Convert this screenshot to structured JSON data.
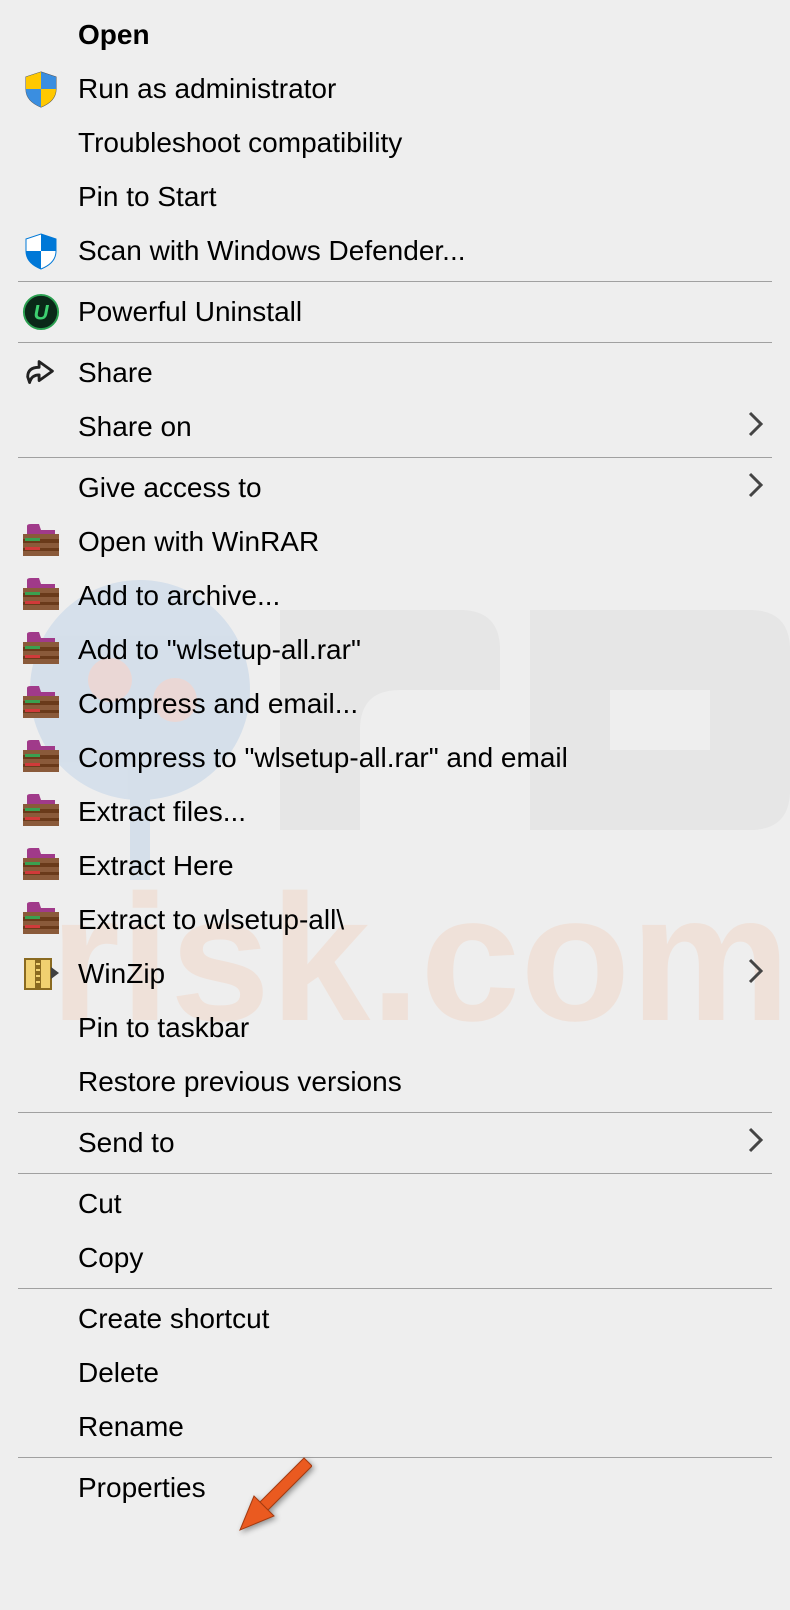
{
  "menu": {
    "open": "Open",
    "run_as_admin": "Run as administrator",
    "troubleshoot": "Troubleshoot compatibility",
    "pin_start": "Pin to Start",
    "scan_defender": "Scan with Windows Defender...",
    "powerful_uninstall": "Powerful Uninstall",
    "share": "Share",
    "share_on": "Share on",
    "give_access": "Give access to",
    "open_winrar": "Open with WinRAR",
    "add_archive": "Add to archive...",
    "add_to_named": "Add to \"wlsetup-all.rar\"",
    "compress_email": "Compress and email...",
    "compress_to_email": "Compress to \"wlsetup-all.rar\" and email",
    "extract_files": "Extract files...",
    "extract_here": "Extract Here",
    "extract_to": "Extract to wlsetup-all\\",
    "winzip": "WinZip",
    "pin_taskbar": "Pin to taskbar",
    "restore_versions": "Restore previous versions",
    "send_to": "Send to",
    "cut": "Cut",
    "copy": "Copy",
    "create_shortcut": "Create shortcut",
    "delete": "Delete",
    "rename": "Rename",
    "properties": "Properties"
  }
}
